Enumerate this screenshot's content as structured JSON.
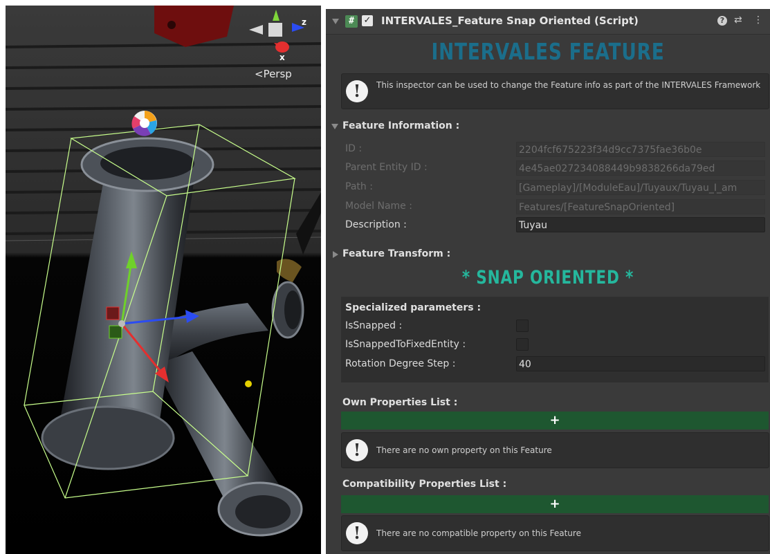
{
  "scene": {
    "projection_label": "<Persp",
    "gizmo_axes": [
      "z",
      "x"
    ]
  },
  "inspector": {
    "component_title": "INTERVALES_Feature Snap Oriented (Script)",
    "script_icon": "#",
    "enabled_check": "✓",
    "header_icons": [
      "help-icon",
      "settings-icon",
      "more-icon"
    ],
    "main_title": "INTERVALES FEATURE",
    "info_message": "This inspector can be used to change the Feature info as part of the INTERVALES Framework",
    "feature_information": {
      "label": "Feature Information :",
      "fields": [
        {
          "label": "ID :",
          "value": "2204fcf675223f34d9cc7375fae36b0e"
        },
        {
          "label": "Parent Entity ID :",
          "value": "4e45ae027234088449b9838266da79ed"
        },
        {
          "label": "Path :",
          "value": "[Gameplay]/[ModuleEau]/Tuyaux/Tuyau_I_am"
        },
        {
          "label": "Model Name :",
          "value": "Features/[FeatureSnapOriented]"
        },
        {
          "label": "Description :",
          "value": "Tuyau"
        }
      ]
    },
    "feature_transform_label": "Feature Transform :",
    "sub_title": "* SNAP ORIENTED *",
    "specialized": {
      "label": "Specialized parameters :",
      "is_snapped_label": "IsSnapped :",
      "is_snapped_fixed_label": "IsSnappedToFixedEntity :",
      "rotation_step_label": "Rotation Degree Step :",
      "rotation_step_value": "40"
    },
    "own_properties": {
      "label": "Own Properties List :",
      "add_label": "+",
      "empty_message": "There are no own property on this Feature"
    },
    "compat_properties": {
      "label": "Compatibility Properties List :",
      "add_label": "+",
      "empty_message": "There are no compatible property on this Feature"
    },
    "colors": {
      "main_title": "#1b6e8b",
      "sub_title": "#25b79d",
      "add_bar": "#1e5730"
    }
  }
}
